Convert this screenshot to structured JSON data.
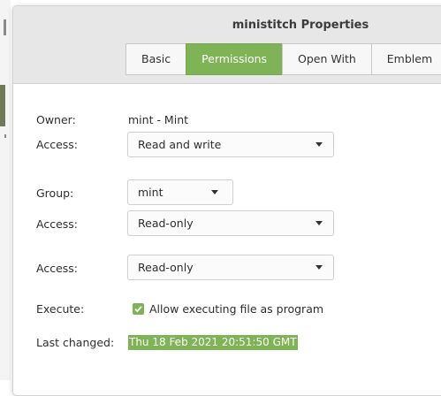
{
  "window": {
    "title": "ministitch Properties"
  },
  "tabs": [
    {
      "label": "Basic",
      "active": false
    },
    {
      "label": "Permissions",
      "active": true
    },
    {
      "label": "Open With",
      "active": false
    },
    {
      "label": "Emblem",
      "active": false
    }
  ],
  "permissions": {
    "owner_label": "Owner:",
    "owner_value": "mint - Mint",
    "owner_access_label": "Access:",
    "owner_access_value": "Read and write",
    "group_label": "Group:",
    "group_value": "mint",
    "group_access_label": "Access:",
    "group_access_value": "Read-only",
    "others_access_label": "Access:",
    "others_access_value": "Read-only",
    "execute_label": "Execute:",
    "execute_checked": true,
    "execute_text": "Allow executing file as program",
    "last_changed_label": "Last changed:",
    "last_changed_value": "Thu 18 Feb 2021 20:51:50 GMT"
  },
  "colors": {
    "accent": "#7eb356",
    "titlebar": "#e7e7e7"
  }
}
